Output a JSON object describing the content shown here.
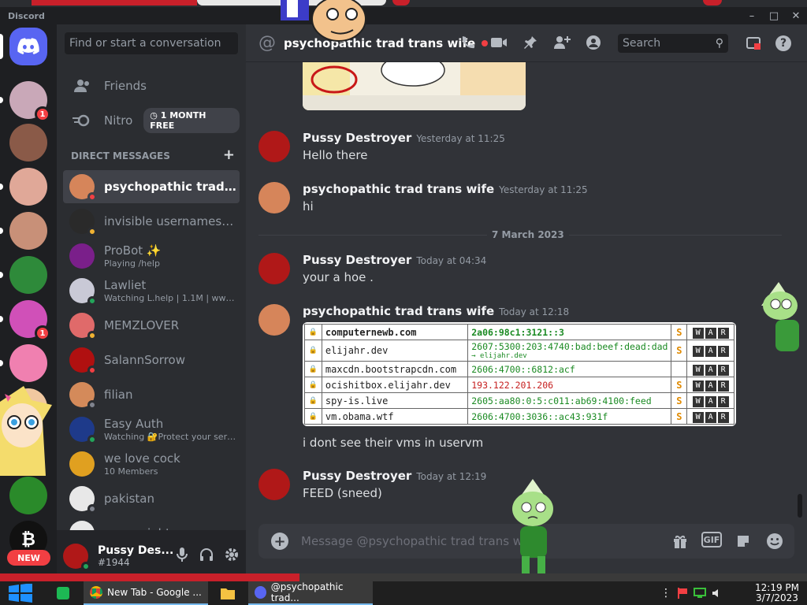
{
  "app": {
    "name": "Discord"
  },
  "search": {
    "placeholder": "Find or start a conversation"
  },
  "nav": {
    "friends": "Friends",
    "nitro": "Nitro",
    "nitro_badge": "1 MONTH FREE"
  },
  "dm_header": "DIRECT MESSAGES",
  "servers": {
    "badge_count": "1",
    "new_label": "NEW"
  },
  "dms": [
    {
      "name": "psychopathic trad tra...",
      "sub": "",
      "status": "dnd",
      "color": "#d6855a"
    },
    {
      "name": "invisible usernames ar...",
      "sub": "",
      "status": "idle",
      "color": "#2a2a2a"
    },
    {
      "name": "ProBot ✨",
      "sub": "Playing /help",
      "status": "",
      "color": "#7a1f8a"
    },
    {
      "name": "Lawliet",
      "sub": "Watching L.help | 1.1M | www.l...",
      "status": "online",
      "color": "#c9c9d6"
    },
    {
      "name": "MEMZLOVER",
      "sub": "",
      "status": "idle",
      "color": "#e06a6a"
    },
    {
      "name": "SalannSorrow",
      "sub": "",
      "status": "dnd",
      "color": "#b01010"
    },
    {
      "name": "filian",
      "sub": "",
      "status": "offline",
      "color": "#d48a5a"
    },
    {
      "name": "Easy Auth",
      "sub": "Watching 🔐Protect your serv...",
      "status": "online",
      "color": "#1e3a8a"
    },
    {
      "name": "we love cock",
      "sub": "10 Members",
      "status": "",
      "color": "#e0a020"
    },
    {
      "name": "pakistan",
      "sub": "",
      "status": "offline",
      "color": "#e8e8e8"
    },
    {
      "name": "overweight",
      "sub": "",
      "status": "",
      "color": "#e8e8e8"
    }
  ],
  "user": {
    "name": "Pussy Des...",
    "tag": "#1944"
  },
  "channel": {
    "name": "psychopathic trad trans wife"
  },
  "header_search": "Search",
  "messages": [
    {
      "author": "Pussy Destroyer",
      "time": "Yesterday at 11:25",
      "text": "Hello there",
      "color": "#b01818"
    },
    {
      "author": "psychopathic trad trans wife",
      "time": "Yesterday at 11:25",
      "text": "hi",
      "color": "#d6855a"
    },
    {
      "author": "Pussy Destroyer",
      "time": "Today at 04:34",
      "text": "your a  hoe .",
      "color": "#b01818"
    },
    {
      "author": "psychopathic trad trans wife",
      "time": "Today at 12:18",
      "text": "i dont see their vms in uservm",
      "color": "#d6855a"
    },
    {
      "author": "Pussy Destroyer",
      "time": "Today at 12:19",
      "text": "FEED (sneed)",
      "color": "#b01818"
    }
  ],
  "date_divider": "7 March 2023",
  "table": [
    {
      "host": "computernewb.com",
      "ip": "2a06:98c1:3121::3",
      "sub": "",
      "s": "S",
      "ipcolor": "green"
    },
    {
      "host": "elijahr.dev",
      "ip": "2607:5300:203:4740:bad:beef:dead:dad",
      "sub": "→ elijahr.dev",
      "s": "S",
      "ipcolor": "green"
    },
    {
      "host": "maxcdn.bootstrapcdn.com",
      "ip": "2606:4700::6812:acf",
      "sub": "",
      "s": "",
      "ipcolor": "green"
    },
    {
      "host": "ocishitbox.elijahr.dev",
      "ip": "193.122.201.206",
      "sub": "",
      "s": "S",
      "ipcolor": "red"
    },
    {
      "host": "spy-is.live",
      "ip": "2605:aa80:0:5:c011:ab69:4100:feed",
      "sub": "",
      "s": "S",
      "ipcolor": "green"
    },
    {
      "host": "vm.obama.wtf",
      "ip": "2606:4700:3036::ac43:931f",
      "sub": "",
      "s": "S",
      "ipcolor": "green"
    }
  ],
  "war_letters": [
    "W",
    "A",
    "R"
  ],
  "composer": {
    "placeholder": "Message @psychopathic trad trans wife",
    "gif": "GIF"
  },
  "taskbar": {
    "chrome": "New Tab - Google ...",
    "discord": "@psychopathic trad...",
    "time": "12:19 PM",
    "date": "3/7/2023"
  },
  "colors": {
    "blurple": "#5865f2",
    "red": "#f23f43",
    "green": "#23a55a",
    "idle": "#f0b232",
    "offline": "#80848e"
  }
}
